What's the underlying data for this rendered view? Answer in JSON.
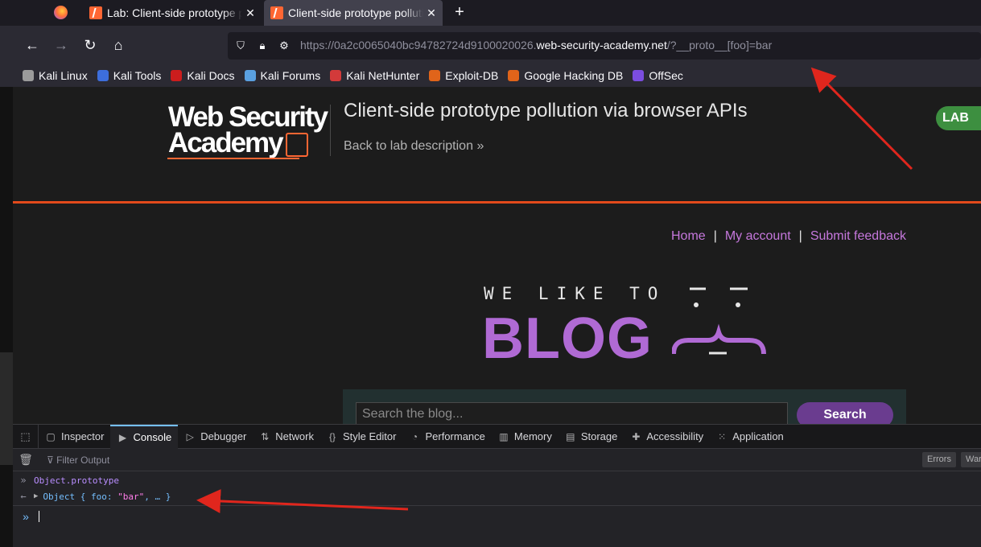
{
  "browser": {
    "tabs": [
      {
        "label": "Lab: Client-side prototype pollution via browser APIs",
        "close": "✕"
      },
      {
        "label": "Client-side prototype pollution via browser APIs",
        "close": "✕"
      }
    ],
    "new_tab": "+",
    "url_prefix": "https://0a2c0065040bc94782724d9100020026.",
    "url_host": "web-security-academy.net",
    "url_path": "/?__proto__[foo]=bar",
    "bookmarks": [
      "Kali Linux",
      "Kali Tools",
      "Kali Docs",
      "Kali Forums",
      "Kali NetHunter",
      "Exploit-DB",
      "Google Hacking DB",
      "OffSec"
    ],
    "bookmark_colors": [
      "#9b9b9b",
      "#3d6edc",
      "#cc1d1d",
      "#5aa0e0",
      "#d33a3a",
      "#e0641a",
      "#e0641a",
      "#7b4de0"
    ]
  },
  "lab": {
    "logo_line1": "Web Security",
    "logo_line2": "Academy",
    "title": "Client-side prototype pollution via browser APIs",
    "back_link": "Back to lab description",
    "back_chevron": "»",
    "badge": "LAB"
  },
  "site": {
    "nav": {
      "home": "Home",
      "separator": "|",
      "account": "My account",
      "feedback": "Submit feedback"
    },
    "banner_small": "WE LIKE TO",
    "banner_big": "BLOG",
    "search_placeholder": "Search the blog...",
    "search_button": "Search"
  },
  "devtools": {
    "tabs": [
      "Inspector",
      "Console",
      "Debugger",
      "Network",
      "Style Editor",
      "Performance",
      "Memory",
      "Storage",
      "Accessibility",
      "Application"
    ],
    "tab_icons": [
      "▢",
      "▶",
      "▷",
      "⇅",
      "{}",
      "◔",
      "▥",
      "▤",
      "✚",
      "⁙"
    ],
    "active_tab": "Console",
    "filter_placeholder": "Filter Output",
    "badge_errors": "Errors",
    "badge_warnings": "Warn",
    "console_input": "Object.prototype",
    "console_output_prefix": "Object { foo: ",
    "console_output_value": "\"bar\"",
    "console_output_suffix": ", … }"
  },
  "colors": {
    "accent_orange": "#e24a1b",
    "link_purple": "#c678dd",
    "blog_purple": "#b06ad4",
    "annotation_red": "#e0261d"
  }
}
